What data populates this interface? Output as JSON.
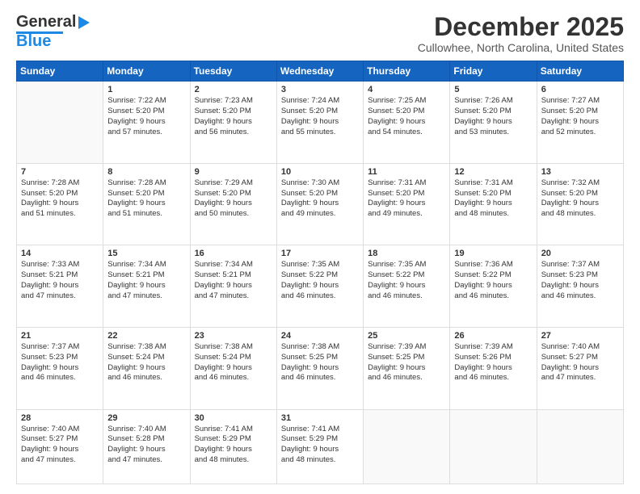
{
  "logo": {
    "line1": "General",
    "line2": "Blue"
  },
  "header": {
    "title": "December 2025",
    "subtitle": "Cullowhee, North Carolina, United States"
  },
  "weekdays": [
    "Sunday",
    "Monday",
    "Tuesday",
    "Wednesday",
    "Thursday",
    "Friday",
    "Saturday"
  ],
  "weeks": [
    [
      {
        "day": "",
        "info": ""
      },
      {
        "day": "1",
        "info": "Sunrise: 7:22 AM\nSunset: 5:20 PM\nDaylight: 9 hours\nand 57 minutes."
      },
      {
        "day": "2",
        "info": "Sunrise: 7:23 AM\nSunset: 5:20 PM\nDaylight: 9 hours\nand 56 minutes."
      },
      {
        "day": "3",
        "info": "Sunrise: 7:24 AM\nSunset: 5:20 PM\nDaylight: 9 hours\nand 55 minutes."
      },
      {
        "day": "4",
        "info": "Sunrise: 7:25 AM\nSunset: 5:20 PM\nDaylight: 9 hours\nand 54 minutes."
      },
      {
        "day": "5",
        "info": "Sunrise: 7:26 AM\nSunset: 5:20 PM\nDaylight: 9 hours\nand 53 minutes."
      },
      {
        "day": "6",
        "info": "Sunrise: 7:27 AM\nSunset: 5:20 PM\nDaylight: 9 hours\nand 52 minutes."
      }
    ],
    [
      {
        "day": "7",
        "info": "Sunrise: 7:28 AM\nSunset: 5:20 PM\nDaylight: 9 hours\nand 51 minutes."
      },
      {
        "day": "8",
        "info": "Sunrise: 7:28 AM\nSunset: 5:20 PM\nDaylight: 9 hours\nand 51 minutes."
      },
      {
        "day": "9",
        "info": "Sunrise: 7:29 AM\nSunset: 5:20 PM\nDaylight: 9 hours\nand 50 minutes."
      },
      {
        "day": "10",
        "info": "Sunrise: 7:30 AM\nSunset: 5:20 PM\nDaylight: 9 hours\nand 49 minutes."
      },
      {
        "day": "11",
        "info": "Sunrise: 7:31 AM\nSunset: 5:20 PM\nDaylight: 9 hours\nand 49 minutes."
      },
      {
        "day": "12",
        "info": "Sunrise: 7:31 AM\nSunset: 5:20 PM\nDaylight: 9 hours\nand 48 minutes."
      },
      {
        "day": "13",
        "info": "Sunrise: 7:32 AM\nSunset: 5:20 PM\nDaylight: 9 hours\nand 48 minutes."
      }
    ],
    [
      {
        "day": "14",
        "info": "Sunrise: 7:33 AM\nSunset: 5:21 PM\nDaylight: 9 hours\nand 47 minutes."
      },
      {
        "day": "15",
        "info": "Sunrise: 7:34 AM\nSunset: 5:21 PM\nDaylight: 9 hours\nand 47 minutes."
      },
      {
        "day": "16",
        "info": "Sunrise: 7:34 AM\nSunset: 5:21 PM\nDaylight: 9 hours\nand 47 minutes."
      },
      {
        "day": "17",
        "info": "Sunrise: 7:35 AM\nSunset: 5:22 PM\nDaylight: 9 hours\nand 46 minutes."
      },
      {
        "day": "18",
        "info": "Sunrise: 7:35 AM\nSunset: 5:22 PM\nDaylight: 9 hours\nand 46 minutes."
      },
      {
        "day": "19",
        "info": "Sunrise: 7:36 AM\nSunset: 5:22 PM\nDaylight: 9 hours\nand 46 minutes."
      },
      {
        "day": "20",
        "info": "Sunrise: 7:37 AM\nSunset: 5:23 PM\nDaylight: 9 hours\nand 46 minutes."
      }
    ],
    [
      {
        "day": "21",
        "info": "Sunrise: 7:37 AM\nSunset: 5:23 PM\nDaylight: 9 hours\nand 46 minutes."
      },
      {
        "day": "22",
        "info": "Sunrise: 7:38 AM\nSunset: 5:24 PM\nDaylight: 9 hours\nand 46 minutes."
      },
      {
        "day": "23",
        "info": "Sunrise: 7:38 AM\nSunset: 5:24 PM\nDaylight: 9 hours\nand 46 minutes."
      },
      {
        "day": "24",
        "info": "Sunrise: 7:38 AM\nSunset: 5:25 PM\nDaylight: 9 hours\nand 46 minutes."
      },
      {
        "day": "25",
        "info": "Sunrise: 7:39 AM\nSunset: 5:25 PM\nDaylight: 9 hours\nand 46 minutes."
      },
      {
        "day": "26",
        "info": "Sunrise: 7:39 AM\nSunset: 5:26 PM\nDaylight: 9 hours\nand 46 minutes."
      },
      {
        "day": "27",
        "info": "Sunrise: 7:40 AM\nSunset: 5:27 PM\nDaylight: 9 hours\nand 47 minutes."
      }
    ],
    [
      {
        "day": "28",
        "info": "Sunrise: 7:40 AM\nSunset: 5:27 PM\nDaylight: 9 hours\nand 47 minutes."
      },
      {
        "day": "29",
        "info": "Sunrise: 7:40 AM\nSunset: 5:28 PM\nDaylight: 9 hours\nand 47 minutes."
      },
      {
        "day": "30",
        "info": "Sunrise: 7:41 AM\nSunset: 5:29 PM\nDaylight: 9 hours\nand 48 minutes."
      },
      {
        "day": "31",
        "info": "Sunrise: 7:41 AM\nSunset: 5:29 PM\nDaylight: 9 hours\nand 48 minutes."
      },
      {
        "day": "",
        "info": ""
      },
      {
        "day": "",
        "info": ""
      },
      {
        "day": "",
        "info": ""
      }
    ]
  ]
}
